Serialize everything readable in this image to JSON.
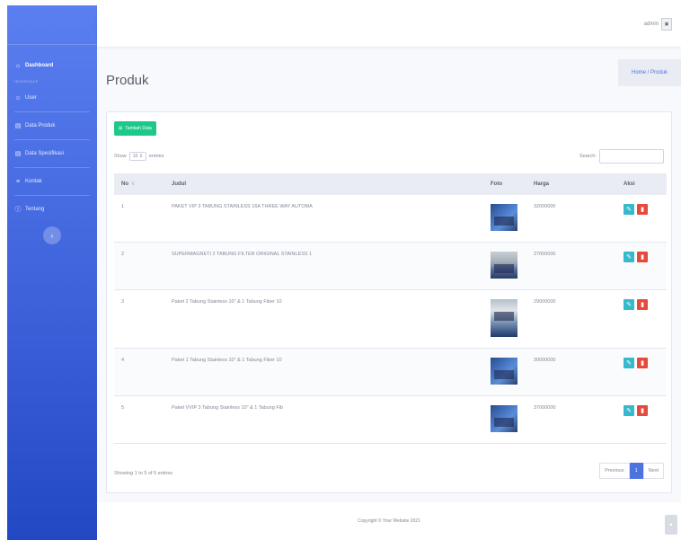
{
  "sidebar": {
    "items": [
      {
        "icon": "home-icon",
        "glyph": "⌂",
        "label": "Dashboard",
        "active": true
      },
      {
        "icon": "user-icon",
        "glyph": "☺",
        "label": "User"
      },
      {
        "icon": "table-icon",
        "glyph": "▤",
        "label": "Data Produk"
      },
      {
        "icon": "table-icon",
        "glyph": "▤",
        "label": "Data Spesifikasi"
      },
      {
        "icon": "list-icon",
        "glyph": "≡",
        "label": "Kontak"
      },
      {
        "icon": "info-icon",
        "glyph": "ⓘ",
        "label": "Tentang"
      }
    ],
    "heading": "INTERFACE",
    "toggle_glyph": "‹"
  },
  "topbar": {
    "user_name": "admin",
    "user_img_alt": "▣"
  },
  "page": {
    "title": "Produk",
    "breadcrumb": "Home / Produk"
  },
  "card": {
    "add_button": "Tambah Data",
    "show_label": "Show",
    "entries_value": "10",
    "entries_label": "entries",
    "search_label": "Search:",
    "columns": [
      "No",
      "Judul",
      "Foto",
      "Harga",
      "Aksi"
    ],
    "rows": [
      {
        "no": "1",
        "judul": "PAKET VIP 3 TABUNG STAINLESS 16A THREE WAY AUTOMA",
        "harga": "32000000"
      },
      {
        "no": "2",
        "judul": "SUPERMAGNETI 2 TABUNG FILTER ORIGINAL STAINLESS 1",
        "harga": "27000000"
      },
      {
        "no": "3",
        "judul": "Paket 2 Tabung Stainless 10\" & 1 Tabung Fiber 10",
        "harga": "29000000"
      },
      {
        "no": "4",
        "judul": "Paket 1 Tabung Stainless 10\" & 1 Tabung Fiber 10",
        "harga": "30000000"
      },
      {
        "no": "5",
        "judul": "Paket VVIP 3 Tabung Stainless 10\" & 1 Tabung Fib",
        "harga": "37000000"
      }
    ],
    "info": "Showing 1 to 5 of 5 entries",
    "pager": {
      "previous": "Previous",
      "current": "1",
      "next": "Next"
    }
  },
  "footer": {
    "copyright": "Copyright © Your Website 2021"
  },
  "colors": {
    "primary": "#4e73df",
    "success": "#1cc88a",
    "info": "#36b9cc",
    "danger": "#e74a3b"
  }
}
